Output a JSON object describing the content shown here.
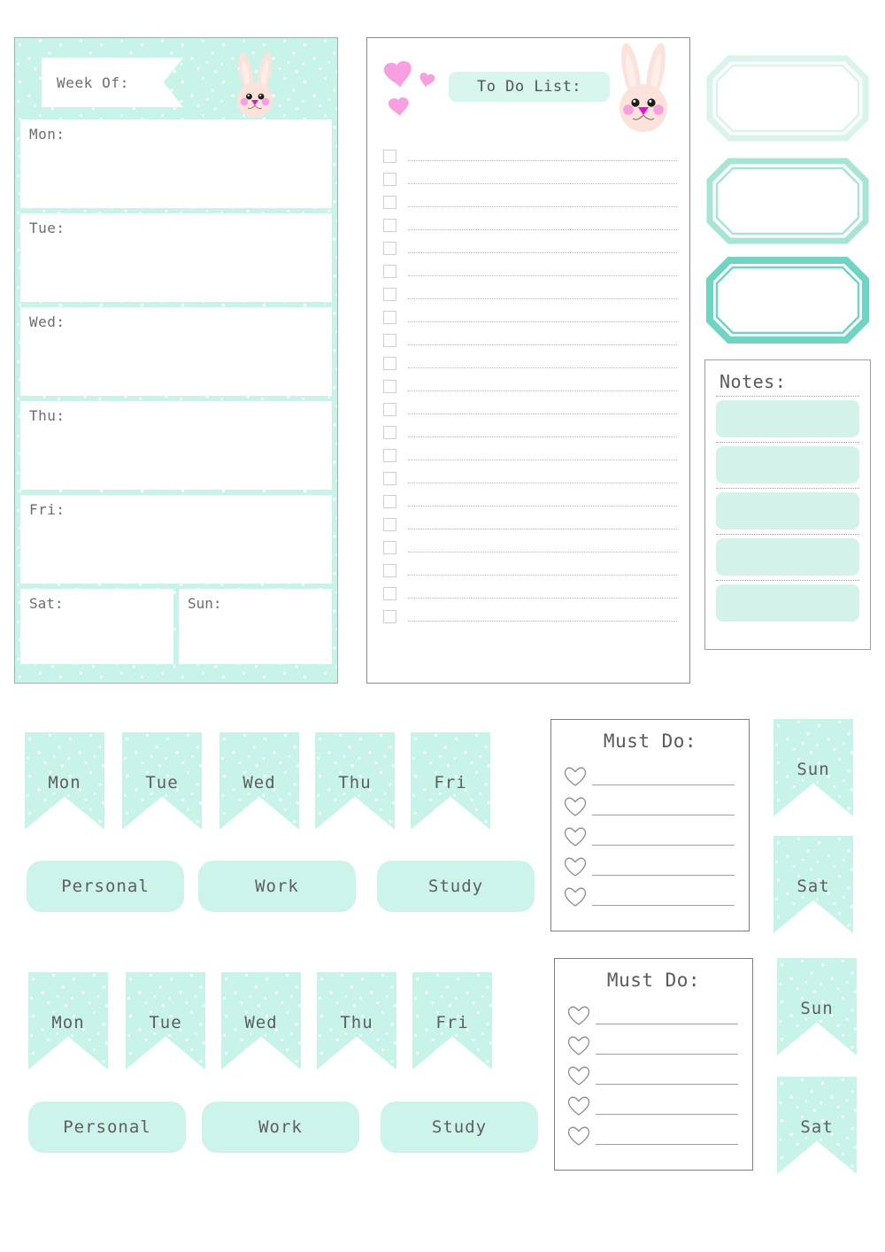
{
  "weekly_planner": {
    "banner_label": "Week Of:",
    "days": [
      {
        "label": "Mon:"
      },
      {
        "label": "Tue:"
      },
      {
        "label": "Wed:"
      },
      {
        "label": "Thu:"
      },
      {
        "label": "Fri:"
      }
    ],
    "weekend": [
      {
        "label": "Sat:"
      },
      {
        "label": "Sun:"
      }
    ],
    "bunny_icon": "bunny-face-icon",
    "background_color": "#c8f3e9"
  },
  "todo_panel": {
    "title": "To Do List:",
    "banner_color": "#d8f5ee",
    "hearts_icon": "hearts-icon",
    "heart_color": "#f9a0e0",
    "bunny_icon": "bunny-face-icon",
    "row_count": 21
  },
  "label_frames": [
    {
      "name": "label-frame-light",
      "color": "#d9f4ec"
    },
    {
      "name": "label-frame-medium",
      "color": "#a8e4d6"
    },
    {
      "name": "label-frame-dark",
      "color": "#6fd4c2"
    }
  ],
  "notes_box": {
    "title": "Notes:",
    "bar_count": 5,
    "bar_color": "#d2f2ea"
  },
  "sticker_rows": [
    {
      "day_flags": [
        "Mon",
        "Tue",
        "Wed",
        "Thu",
        "Fri"
      ],
      "pills": [
        "Personal",
        "Work",
        "Study"
      ],
      "weekend_flags": [
        "Sun",
        "Sat"
      ],
      "must_do": {
        "title": "Must Do:",
        "line_count": 5,
        "heart_icon": "heart-outline-icon"
      }
    },
    {
      "day_flags": [
        "Mon",
        "Tue",
        "Wed",
        "Thu",
        "Fri"
      ],
      "pills": [
        "Personal",
        "Work",
        "Study"
      ],
      "weekend_flags": [
        "Sun",
        "Sat"
      ],
      "must_do": {
        "title": "Must Do:",
        "line_count": 5,
        "heart_icon": "heart-outline-icon"
      }
    }
  ],
  "theme": {
    "mint": "#c8f3e9",
    "mint_light": "#d8f5ee",
    "mint_dark": "#6fd4c2",
    "pink": "#f9a0e0",
    "bunny_skin": "#fbe2db",
    "ink": "#5e5e5e"
  }
}
